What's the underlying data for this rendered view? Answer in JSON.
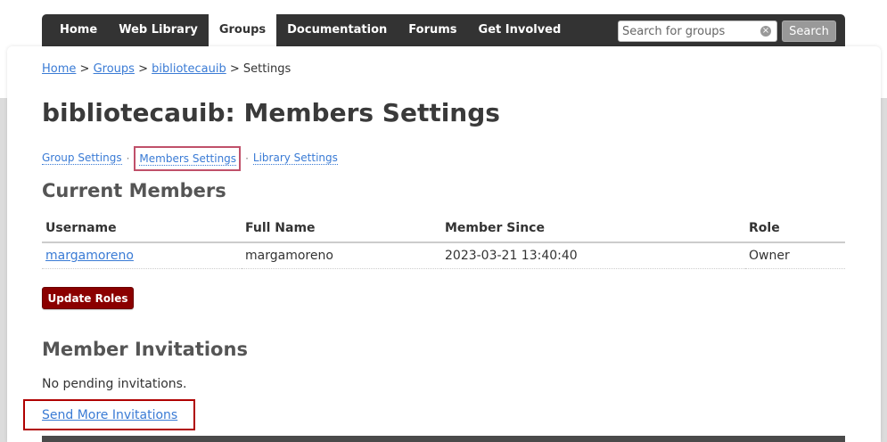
{
  "nav": {
    "tabs": [
      "Home",
      "Web Library",
      "Groups",
      "Documentation",
      "Forums",
      "Get Involved"
    ],
    "active_tab": "Groups",
    "search_placeholder": "Search for groups",
    "search_button": "Search",
    "clear_symbol": "×"
  },
  "breadcrumb": {
    "items": [
      "Home",
      "Groups",
      "bibliotecauib"
    ],
    "separator": ">",
    "current": "Settings"
  },
  "page_title": "bibliotecauib: Members Settings",
  "subnav": {
    "items": [
      "Group Settings",
      "Members Settings",
      "Library Settings"
    ],
    "separator": "·",
    "active": "Members Settings"
  },
  "current_members": {
    "title": "Current Members",
    "columns": [
      "Username",
      "Full Name",
      "Member Since",
      "Role"
    ],
    "rows": [
      {
        "username": "margamoreno",
        "full_name": "margamoreno",
        "member_since": "2023-03-21 13:40:40",
        "role": "Owner"
      }
    ],
    "update_button": "Update Roles"
  },
  "member_invitations": {
    "title": "Member Invitations",
    "empty_text": "No pending invitations.",
    "send_link": "Send More Invitations"
  },
  "colors": {
    "nav_bg": "#333333",
    "link": "#3a7bd5",
    "button_red": "#8b0000",
    "highlight_pink": "#c0506a",
    "highlight_red": "#b00000"
  }
}
